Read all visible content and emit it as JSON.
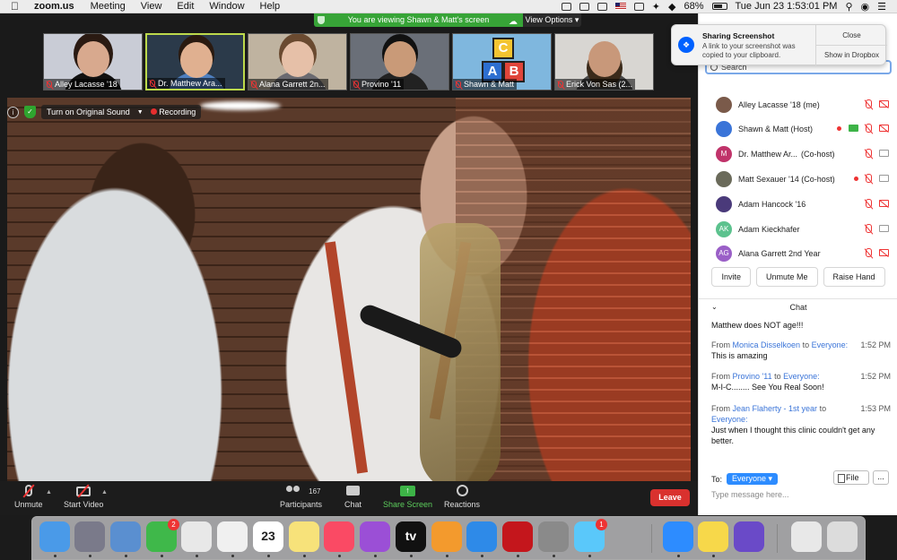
{
  "menubar": {
    "app_name": "zoom.us",
    "items": [
      "Meeting",
      "View",
      "Edit",
      "Window",
      "Help"
    ],
    "battery": "68%",
    "datetime": "Tue Jun 23  1:53:01 PM"
  },
  "banner": {
    "viewing_text": "You are viewing Shawn & Matt's screen",
    "view_options": "View Options"
  },
  "thumbnails": [
    {
      "name": "Alley Lacasse '18"
    },
    {
      "name": "Dr. Matthew Ara..."
    },
    {
      "name": "Alana Garrett 2n..."
    },
    {
      "name": "Provino '11"
    },
    {
      "name": "Shawn & Matt"
    },
    {
      "name": "Erick Von Sas (2..."
    }
  ],
  "logo_letters": [
    "A",
    "C",
    "B"
  ],
  "video_tools": {
    "info": "i",
    "original_sound": "Turn on Original Sound",
    "recording": "Recording"
  },
  "toolbar": {
    "unmute": "Unmute",
    "start_video": "Start Video",
    "participants": "Participants",
    "participant_count": "167",
    "chat": "Chat",
    "share_screen": "Share Screen",
    "reactions": "Reactions",
    "leave": "Leave"
  },
  "notification": {
    "title": "Sharing Screenshot",
    "body": "A link to your screenshot was copied to your clipboard.",
    "close": "Close",
    "show": "Show in Dropbox"
  },
  "panel": {
    "search_placeholder": "Search",
    "participants": [
      {
        "name": "Alley Lacasse '18 (me)",
        "role": "",
        "initials": "",
        "color": "#7a5a4a"
      },
      {
        "name": "Shawn & Matt (Host)",
        "role": "",
        "initials": "",
        "color": "#3a74d8"
      },
      {
        "name": "Dr. Matthew Ar...",
        "role": "(Co-host)",
        "initials": "M",
        "color": "#c0336a"
      },
      {
        "name": "Matt Sexauer '14 (Co-host)",
        "role": "",
        "initials": "",
        "color": "#6a6a5a"
      },
      {
        "name": "Adam Hancock '16",
        "role": "",
        "initials": "",
        "color": "#4a3a7a"
      },
      {
        "name": "Adam Kieckhafer",
        "role": "",
        "initials": "AK",
        "color": "#5cc28e"
      },
      {
        "name": "Alana Garrett 2nd Year",
        "role": "",
        "initials": "AG",
        "color": "#9a5fc7"
      }
    ],
    "buttons": {
      "invite": "Invite",
      "unmute_me": "Unmute Me",
      "raise_hand": "Raise Hand"
    }
  },
  "chat": {
    "title": "Chat",
    "messages": [
      {
        "from": "",
        "to": "",
        "time": "",
        "text": "Matthew does NOT age!!!"
      },
      {
        "from": "Monica Disselkoen",
        "to": "Everyone:",
        "time": "1:52 PM",
        "text": "This is amazing"
      },
      {
        "from": "Provino '11",
        "to": "Everyone:",
        "time": "1:52 PM",
        "text": "M-I-C........ See You Real Soon!"
      },
      {
        "from": "Jean Flaherty - 1st year",
        "to": "Everyone:",
        "time": "1:53 PM",
        "text": "Just when I thought this clinic couldn't get any better."
      }
    ],
    "from_word": "From",
    "to_word": "to",
    "to_label": "To:",
    "to_value": "Everyone",
    "file": "File",
    "more": "...",
    "input_placeholder": "Type message here..."
  },
  "dock": {
    "apps": [
      {
        "name": "finder",
        "color": "#4a9ae8"
      },
      {
        "name": "launchpad",
        "color": "#7a7a8a"
      },
      {
        "name": "preview",
        "color": "#5a8fd0"
      },
      {
        "name": "facetime",
        "color": "#3fb84a",
        "badge": "2"
      },
      {
        "name": "chrome",
        "color": "#e8e8e8"
      },
      {
        "name": "photos",
        "color": "#f0f0f0"
      },
      {
        "name": "calendar",
        "color": "#ffffff",
        "label": "23"
      },
      {
        "name": "notes",
        "color": "#f7e27a"
      },
      {
        "name": "music",
        "color": "#fa4a64"
      },
      {
        "name": "podcasts",
        "color": "#9b4fd6"
      },
      {
        "name": "tv",
        "color": "#111111",
        "label": "tv"
      },
      {
        "name": "pages",
        "color": "#f39a2d"
      },
      {
        "name": "app-store",
        "color": "#2e8ae8"
      },
      {
        "name": "acrobat",
        "color": "#c4161c"
      },
      {
        "name": "system-preferences",
        "color": "#8a8a8a"
      },
      {
        "name": "messages",
        "color": "#5ac8fa",
        "badge": "1"
      },
      {
        "name": "zoom",
        "color": "#2d8cff"
      },
      {
        "name": "stickies",
        "color": "#f7d84a"
      },
      {
        "name": "imovie",
        "color": "#6a4ac8"
      },
      {
        "name": "xlsx-file",
        "color": "#e8e8e8"
      },
      {
        "name": "trash",
        "color": "#dcdcdc"
      }
    ]
  }
}
